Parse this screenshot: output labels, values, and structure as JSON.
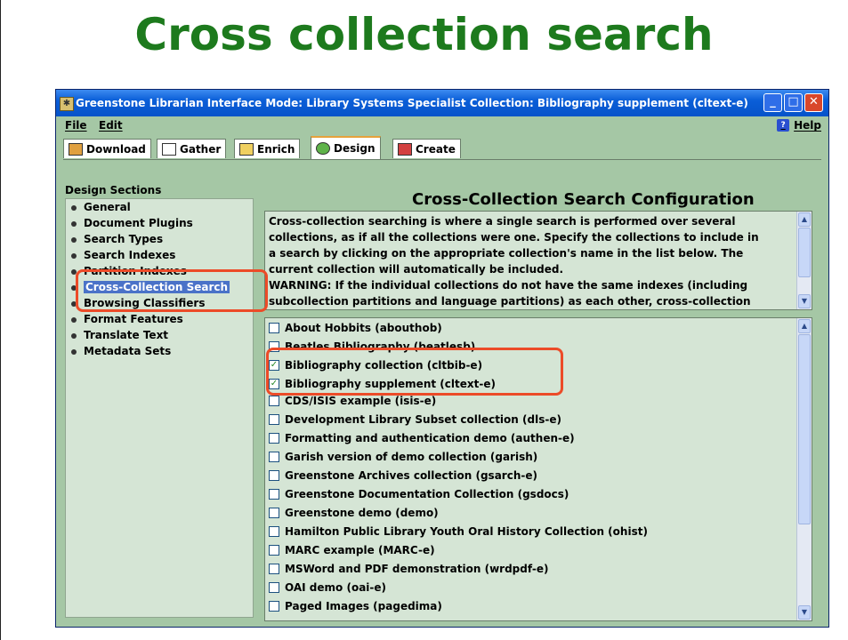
{
  "slide": {
    "title": "Cross collection search"
  },
  "window": {
    "title": "Greenstone Librarian Interface  Mode: Library Systems Specialist  Collection: Bibliography supplement (cltext-e)",
    "menu": {
      "file": "File",
      "edit": "Edit",
      "help": "Help"
    },
    "tabs": [
      "Download",
      "Gather",
      "Enrich",
      "Design",
      "Create"
    ],
    "active_tab": "Design"
  },
  "design": {
    "heading": "Design Sections",
    "sections": [
      "General",
      "Document Plugins",
      "Search Types",
      "Search Indexes",
      "Partition Indexes",
      "Cross-Collection Search",
      "Browsing Classifiers",
      "Format Features",
      "Translate Text",
      "Metadata Sets"
    ],
    "selected_section": "Cross-Collection Search"
  },
  "main": {
    "title": "Cross-Collection Search Configuration",
    "description": [
      "Cross-collection searching is where a single search is performed over several",
      "collections, as if all the collections were one. Specify the collections to include in",
      "a search by clicking on the appropriate collection's name in the list below. The",
      "current collection will automatically be included.",
      "WARNING: If the individual collections do not have the same indexes (including",
      "subcollection partitions and language partitions) as each other, cross-collection"
    ],
    "collections": [
      {
        "label": "About Hobbits (abouthob)",
        "checked": false
      },
      {
        "label": "Beatles Bibliography (beatlesb)",
        "checked": false
      },
      {
        "label": "Bibliography collection (cltbib-e)",
        "checked": true
      },
      {
        "label": "Bibliography supplement (cltext-e)",
        "checked": true
      },
      {
        "label": "CDS/ISIS example (isis-e)",
        "checked": false
      },
      {
        "label": "Development Library Subset collection (dls-e)",
        "checked": false
      },
      {
        "label": "Formatting and authentication demo (authen-e)",
        "checked": false
      },
      {
        "label": "Garish version of demo collection (garish)",
        "checked": false
      },
      {
        "label": "Greenstone Archives collection (gsarch-e)",
        "checked": false
      },
      {
        "label": "Greenstone Documentation Collection (gsdocs)",
        "checked": false
      },
      {
        "label": "Greenstone demo (demo)",
        "checked": false
      },
      {
        "label": "Hamilton Public Library Youth Oral History Collection (ohist)",
        "checked": false
      },
      {
        "label": "MARC example (MARC-e)",
        "checked": false
      },
      {
        "label": "MSWord and PDF demonstration (wrdpdf-e)",
        "checked": false
      },
      {
        "label": "OAI demo (oai-e)",
        "checked": false
      },
      {
        "label": "Paged Images (pagedima)",
        "checked": false
      }
    ]
  },
  "colors": {
    "title_green": "#1d7a1d",
    "highlight_red": "#ec4b28",
    "panel_green": "#a5c7a5",
    "list_bg": "#d5e5d5"
  }
}
